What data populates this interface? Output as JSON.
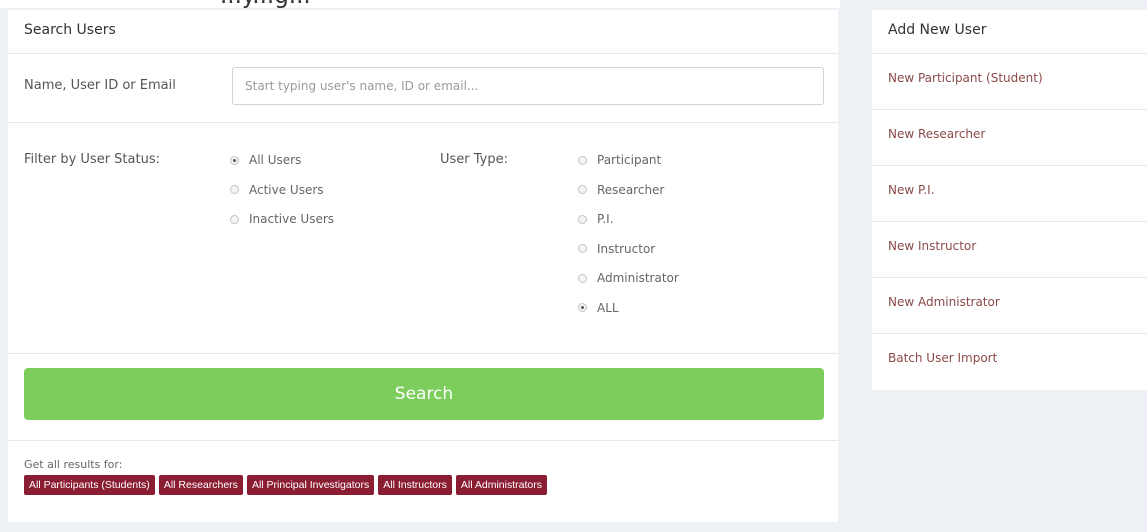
{
  "search_panel": {
    "title": "Search Users",
    "name_field": {
      "label": "Name, User ID or Email",
      "placeholder": "Start typing user's name, ID or email...",
      "value": ""
    },
    "status_filter": {
      "label": "Filter by User Status:",
      "options": [
        {
          "label": "All Users",
          "checked": true
        },
        {
          "label": "Active Users",
          "checked": false
        },
        {
          "label": "Inactive Users",
          "checked": false
        }
      ]
    },
    "type_filter": {
      "label": "User Type:",
      "options": [
        {
          "label": "Participant",
          "checked": false
        },
        {
          "label": "Researcher",
          "checked": false
        },
        {
          "label": "P.I.",
          "checked": false
        },
        {
          "label": "Instructor",
          "checked": false
        },
        {
          "label": "Administrator",
          "checked": false
        },
        {
          "label": "ALL",
          "checked": true
        }
      ]
    },
    "search_button": "Search",
    "results": {
      "label": "Get all results for:",
      "badges": [
        "All Participants (Students)",
        "All Researchers",
        "All Principal Investigators",
        "All Instructors",
        "All Administrators"
      ]
    }
  },
  "add_panel": {
    "title": "Add New User",
    "items": [
      "New Participant (Student)",
      "New Researcher",
      "New P.I.",
      "New Instructor",
      "New Administrator",
      "Batch User Import"
    ]
  },
  "colors": {
    "search_button": "#7ccd5c",
    "badge": "#8b1d33",
    "link": "#8b4a4a",
    "page_background": "#eef1f6"
  }
}
